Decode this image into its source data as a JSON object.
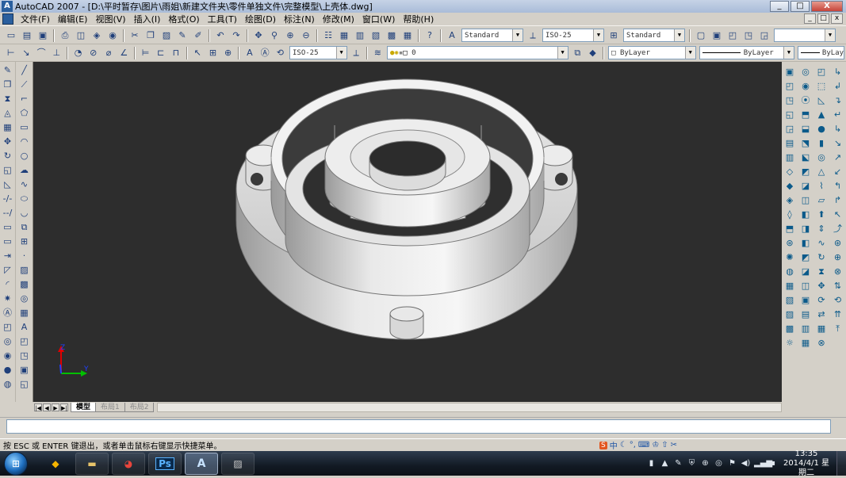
{
  "window": {
    "title": "AutoCAD 2007 - [D:\\平时暂存\\图片\\雨姐\\新建文件夹\\零件单独文件\\完整模型\\上壳体.dwg]",
    "minimize_label": "_",
    "maximize_label": "□",
    "close_label": "X"
  },
  "menu": {
    "items": [
      {
        "label": "文件(F)"
      },
      {
        "label": "编辑(E)"
      },
      {
        "label": "视图(V)"
      },
      {
        "label": "插入(I)"
      },
      {
        "label": "格式(O)"
      },
      {
        "label": "工具(T)"
      },
      {
        "label": "绘图(D)"
      },
      {
        "label": "标注(N)"
      },
      {
        "label": "修改(M)"
      },
      {
        "label": "窗口(W)"
      },
      {
        "label": "帮助(H)"
      }
    ],
    "doc_min": "_",
    "doc_restore": "□",
    "doc_close": "x"
  },
  "toolbar1": {
    "text_style": "Standard",
    "dim_style": "ISO-25",
    "table_style": "Standard",
    "extra_combo": ""
  },
  "toolbar2": {
    "dim_style": "ISO-25",
    "layer": "0",
    "color": "ByLayer",
    "linetype": "ByLayer",
    "lineweight": "ByLay"
  },
  "ucs": {
    "x_label": "Y",
    "z_label": "Z"
  },
  "layout_tabs": [
    {
      "label": "模型",
      "active": true
    },
    {
      "label": "布局1",
      "active": false
    },
    {
      "label": "布局2",
      "active": false
    }
  ],
  "status": {
    "prompt": "按 ESC 或 ENTER 键退出，或者单击鼠标右键显示快捷菜单。",
    "ime_logo": "S",
    "ime_mode": "中"
  },
  "taskbar": {
    "apps": [
      "file-explorer",
      "chrome",
      "photoshop",
      "autocad",
      "photo-viewer"
    ],
    "ps_label": "Ps",
    "clock_time": "13:35",
    "clock_date": "2014/4/1 星期二"
  },
  "colors": {
    "canvas_bg": "#2d2d2d",
    "model_light": "#efefef",
    "model_mid": "#bdbdbd",
    "model_dark": "#8a8a8a",
    "ucs_x": "#00c000",
    "ucs_y": "#2040ff",
    "ucs_z": "#e00000"
  }
}
